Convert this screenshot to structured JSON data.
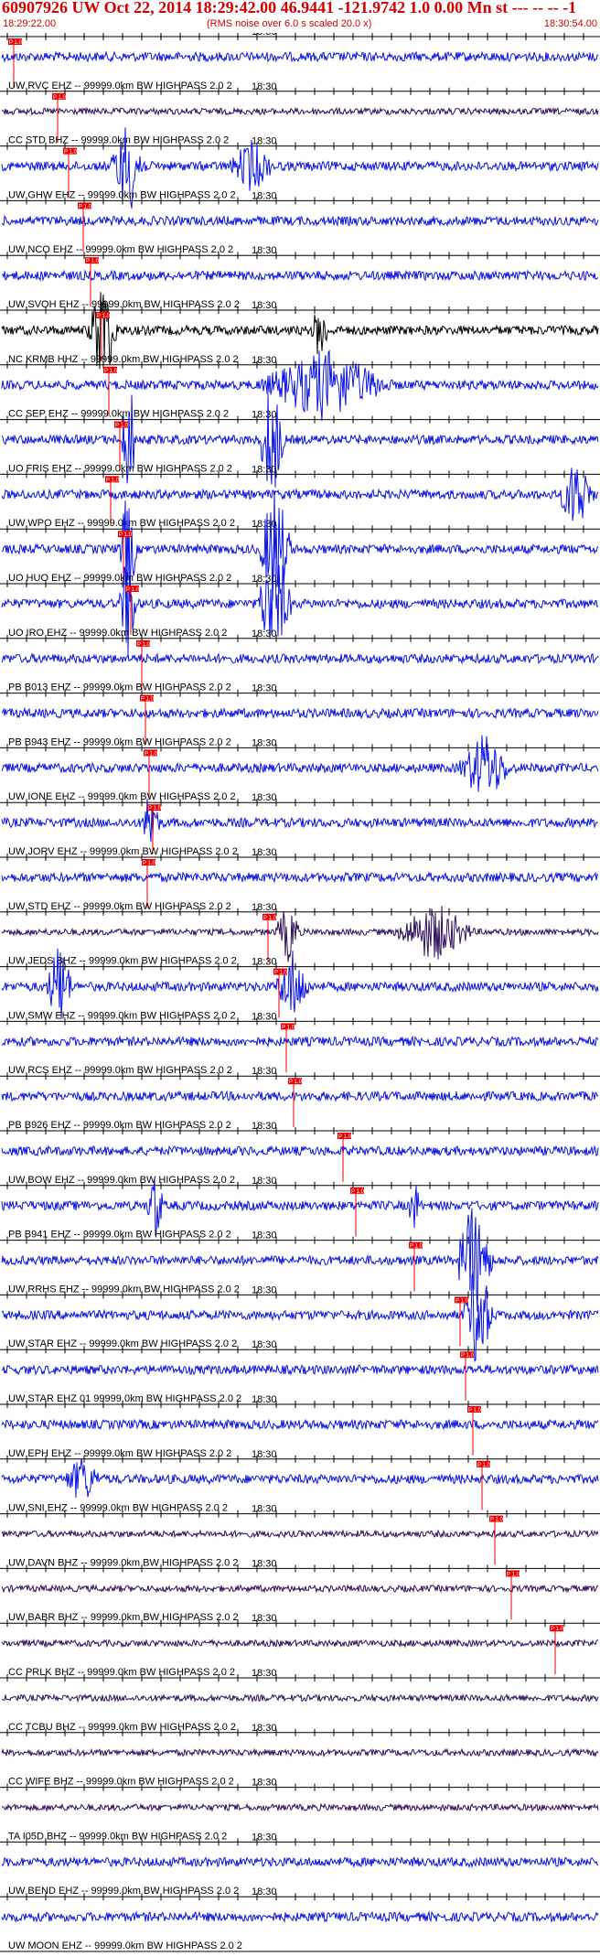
{
  "header": {
    "title": "60907926 UW Oct 22, 2014 18:29:42.00   46.9441 -121.9742  1.0 0.00 Mn st --- -- --  -1",
    "start_time": "18:29:22.00",
    "scale_note": "(RMS noise over 6.0 s scaled 20.0 x)",
    "end_time": "18:30:54.00"
  },
  "time_marker": "18:30",
  "pick_label": "P 1.0",
  "colors": {
    "blue": "#0a14e6",
    "black": "#000000",
    "purple": "#2e0f5c",
    "red": "#ee0000"
  },
  "traces": [
    {
      "label": "UW RVC EHZ -- 99999.0km BW  HIGHPASS  2.0  2",
      "color": "blue"
    },
    {
      "label": "CC STD BHZ -- 99999.0km BW  HIGHPASS  2.0  2",
      "color": "purple"
    },
    {
      "label": "UW GHW EHZ -- 99999.0km BW  HIGHPASS  2.0  2",
      "color": "blue"
    },
    {
      "label": "UW NCO EHZ -- 99999.0km BW  HIGHPASS  2.0  2",
      "color": "blue"
    },
    {
      "label": "UW SVOH EHZ -- 99999.0km BW  HIGHPASS  2.0  2",
      "color": "blue"
    },
    {
      "label": "NC KRMB HHZ -- 99999.0km BW  HIGHPASS  2.0  2",
      "color": "black"
    },
    {
      "label": "CC SEP EHZ -- 99999.0km BW  HIGHPASS  2.0  2",
      "color": "blue"
    },
    {
      "label": "UO FRIS EHZ -- 99999.0km BW  HIGHPASS  2.0  2",
      "color": "blue"
    },
    {
      "label": "UW WPO EHZ -- 99999.0km BW  HIGHPASS  2.0  2",
      "color": "blue"
    },
    {
      "label": "UO HUO EHZ -- 99999.0km BW  HIGHPASS  2.0  2",
      "color": "blue"
    },
    {
      "label": "UO IRO EHZ -- 99999.0km BW  HIGHPASS  2.0  2",
      "color": "blue"
    },
    {
      "label": "PB B013 EHZ -- 99999.0km BW  HIGHPASS  2.0  2",
      "color": "blue"
    },
    {
      "label": "PB B943 EHZ -- 99999.0km BW  HIGHPASS  2.0  2",
      "color": "blue"
    },
    {
      "label": "UW IONE EHZ -- 99999.0km BW  HIGHPASS  2.0  2",
      "color": "blue"
    },
    {
      "label": "UW JORV EHZ -- 99999.0km BW  HIGHPASS  2.0  2",
      "color": "blue"
    },
    {
      "label": "UW STD EHZ -- 99999.0km BW  HIGHPASS  2.0  2",
      "color": "blue"
    },
    {
      "label": "UW JEDS BHZ -- 99999.0km BW  HIGHPASS  2.0  2",
      "color": "purple"
    },
    {
      "label": "UW SMW EHZ -- 99999.0km BW  HIGHPASS  2.0  2",
      "color": "blue"
    },
    {
      "label": "UW RCS EHZ -- 99999.0km BW  HIGHPASS  2.0  2",
      "color": "blue"
    },
    {
      "label": "PB B926 EHZ -- 99999.0km BW  HIGHPASS  2.0  2",
      "color": "blue"
    },
    {
      "label": "UW BOW EHZ -- 99999.0km BW  HIGHPASS  2.0  2",
      "color": "blue"
    },
    {
      "label": "PB B941 EHZ -- 99999.0km BW  HIGHPASS  2.0  2",
      "color": "blue"
    },
    {
      "label": "UW RRHS EHZ -- 99999.0km BW  HIGHPASS  2.0  2",
      "color": "blue"
    },
    {
      "label": "UW STAR EHZ -- 99999.0km BW  HIGHPASS  2.0  2",
      "color": "blue"
    },
    {
      "label": "UW STAR EHZ 01 99999.0km BW  HIGHPASS  2.0  2",
      "color": "blue"
    },
    {
      "label": "UW EPH EHZ -- 99999.0km BW  HIGHPASS  2.0  2",
      "color": "blue"
    },
    {
      "label": "UW SNI EHZ -- 99999.0km BW  HIGHPASS  2.0  2",
      "color": "blue"
    },
    {
      "label": "UW DAVN BHZ -- 99999.0km BW  HIGHPASS  2.0  2",
      "color": "purple"
    },
    {
      "label": "UW BABR BHZ -- 99999.0km BW  HIGHPASS  2.0  2",
      "color": "purple"
    },
    {
      "label": "CC PRLK BHZ -- 99999.0km BW  HIGHPASS  2.0  2",
      "color": "purple"
    },
    {
      "label": "CC TCBU BHZ -- 99999.0km BW  HIGHPASS  2.0  2",
      "color": "purple"
    },
    {
      "label": "CC WIFE BHZ -- 99999.0km BW  HIGHPASS  2.0  2",
      "color": "purple"
    },
    {
      "label": "TA I05D BHZ -- 99999.0km BW  HIGHPASS  2.0  2",
      "color": "purple"
    },
    {
      "label": "UW BEND EHZ -- 99999.0km BW  HIGHPASS  2.0  2",
      "color": "blue"
    },
    {
      "label": "UW MOON EHZ -- 99999.0km BW  HIGHPASS  2.0  2",
      "color": "blue"
    }
  ]
}
